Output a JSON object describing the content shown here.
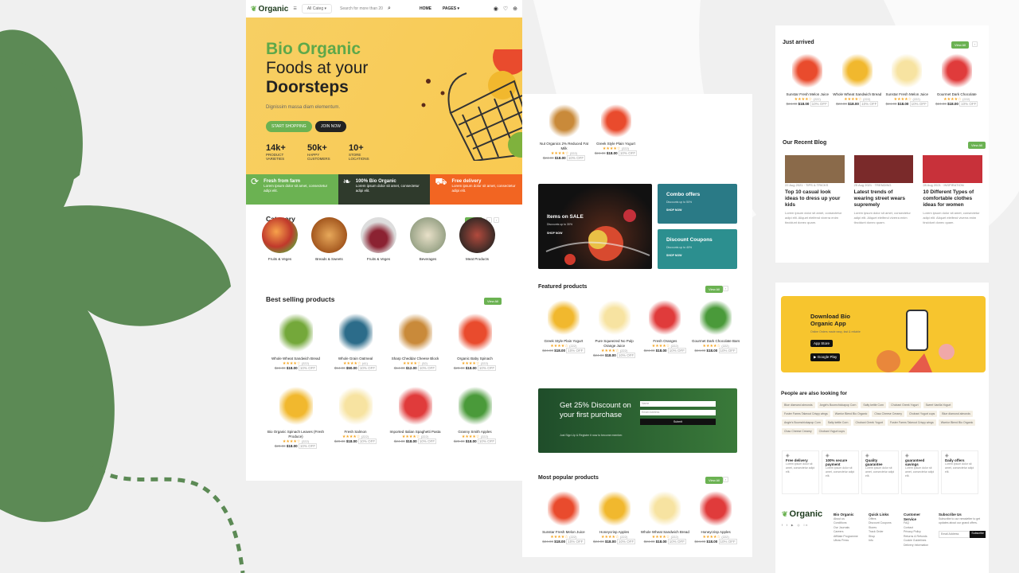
{
  "colors": {
    "brand": "#6bb252",
    "dark": "#1f3a26",
    "orange": "#f26522",
    "hero": "#f7cf63",
    "bg": "#f0f0f0",
    "decor": "#5c8a55"
  },
  "header": {
    "logo": "Organic",
    "category": "All Categ",
    "search_placeholder": "Search for more than 20,0",
    "nav": [
      "HOME",
      "PAGES ▾"
    ],
    "icons": [
      "user-icon",
      "wishlist-icon",
      "cart-icon"
    ]
  },
  "hero": {
    "line1": "Bio Organic",
    "line2": "Foods at your",
    "line3": "Doorsteps",
    "sub": "Dignissim massa diam elementum.",
    "btn1": "START SHOPPING",
    "btn2": "JOIN NOW",
    "stats": [
      {
        "n": "14k+",
        "l": "PRODUCT VARIETIES"
      },
      {
        "n": "50k+",
        "l": "HAPPY CUSTOMERS"
      },
      {
        "n": "10+",
        "l": "STORE LOCATIONS"
      }
    ],
    "features": [
      {
        "t": "Fresh from farm",
        "d": "Lorem ipsum dolor sit amet, consectetur adipi elit.",
        "icon": "recycle-icon"
      },
      {
        "t": "100% Bio Organic",
        "d": "Lorem ipsum dolor sit amet, consectetur adipi elit.",
        "icon": "leaf-icon"
      },
      {
        "t": "Free delivery",
        "d": "Lorem ipsum dolor sit amet, consectetur adipi elit.",
        "icon": "truck-icon"
      }
    ]
  },
  "category": {
    "title": "Category",
    "view_all": "View All",
    "items": [
      "Fruits & Veges",
      "Breads & Sweets",
      "Fruits & Veges",
      "Beverages",
      "Meat Products"
    ]
  },
  "best": {
    "title": "Best selling products",
    "view_all": "View All",
    "items": [
      {
        "name": "Whole Wheat Sandwich Bread",
        "count": "(222)",
        "old": "$24.00",
        "price": "$18.00",
        "off": "10% OFF"
      },
      {
        "name": "Whole Grain Oatmeal",
        "count": "(41)",
        "old": "$54.00",
        "price": "$50.00",
        "off": "10% OFF"
      },
      {
        "name": "Sharp Cheddar Cheese Block",
        "count": "(32)",
        "old": "$14.00",
        "price": "$12.00",
        "off": "10% OFF"
      },
      {
        "name": "Organic Baby Spinach",
        "count": "(222)",
        "old": "$20.00",
        "price": "$18.00",
        "off": "10% OFF"
      },
      {
        "name": "Bio Organic Spinach Leaves (Fresh Produce)",
        "count": "(222)",
        "old": "$20.00",
        "price": "$18.00",
        "off": "10% OFF"
      },
      {
        "name": "Fresh Salmon",
        "count": "(222)",
        "old": "$20.00",
        "price": "$18.00",
        "off": "10% OFF"
      },
      {
        "name": "Imported Italian Spaghetti Pasta",
        "count": "(222)",
        "old": "$24.00",
        "price": "$18.00",
        "off": "10% OFF"
      },
      {
        "name": "Granny Smith Apples",
        "count": "(222)",
        "old": "$20.00",
        "price": "$18.00",
        "off": "10% OFF"
      }
    ]
  },
  "mid_top": [
    {
      "name": "Nut Organics 2% Reduced Fat Milk",
      "count": "(222)",
      "old": "$24.00",
      "price": "$18.00",
      "off": "10% OFF"
    },
    {
      "name": "Greek Style Plain Yogurt",
      "count": "(222)",
      "old": "$24.00",
      "price": "$18.00",
      "off": "10% OFF"
    }
  ],
  "promos": {
    "sale": "Items on SALE",
    "sale_sub": "Discounts up to 30%",
    "combo": "Combo offers",
    "combo_sub": "Discounts up to 50%",
    "coupon": "Discount Coupons",
    "coupon_sub": "Discounts up to 40%",
    "link": "SHOP NOW"
  },
  "featured": {
    "title": "Featured products",
    "view_all": "View All",
    "items": [
      {
        "name": "Greek Style Plain Yogurt",
        "count": "(222)",
        "old": "$24.00",
        "price": "$18.00",
        "off": "10% OFF"
      },
      {
        "name": "Pure Squeezed No Pulp Orange Juice",
        "count": "(222)",
        "old": "$24.00",
        "price": "$18.00",
        "off": "10% OFF"
      },
      {
        "name": "Fresh Oranges",
        "count": "(222)",
        "old": "$24.00",
        "price": "$18.00",
        "off": "10% OFF"
      },
      {
        "name": "Gourmet Dark Chocolate Bars",
        "count": "(222)",
        "old": "$24.00",
        "price": "$18.00",
        "off": "10% OFF"
      }
    ]
  },
  "newsletter": {
    "title": "Get 25% Discount on your first purchase",
    "sub": "Just Sign Up & Register it now to become member.",
    "name_ph": "Name",
    "email_ph": "Email Address",
    "submit": "Submit"
  },
  "popular": {
    "title": "Most popular products",
    "view_all": "View All",
    "items": [
      {
        "name": "Sunstar Fresh Melon Juice",
        "count": "(222)",
        "old": "$24.00",
        "price": "$18.00",
        "off": "10% OFF"
      },
      {
        "name": "Honeycrisp Apples",
        "count": "(222)",
        "old": "$24.00",
        "price": "$18.00",
        "off": "10% OFF"
      },
      {
        "name": "Whole Wheat Sandwich Bread",
        "count": "(222)",
        "old": "$24.00",
        "price": "$18.00",
        "off": "10% OFF"
      },
      {
        "name": "Honeycrisp Apples",
        "count": "(222)",
        "old": "$24.00",
        "price": "$18.00",
        "off": "10% OFF"
      }
    ]
  },
  "arrived": {
    "title": "Just arrived",
    "view_all": "View All",
    "items": [
      {
        "name": "Sunstar Fresh Melon Juice",
        "count": "(222)",
        "old": "$24.00",
        "price": "$18.00",
        "off": "10% OFF"
      },
      {
        "name": "Whole Wheat Sandwich Bread",
        "count": "(222)",
        "old": "$24.00",
        "price": "$18.00",
        "off": "10% OFF"
      },
      {
        "name": "Sunstar Fresh Melon Juice",
        "count": "(222)",
        "old": "$24.00",
        "price": "$18.00",
        "off": "10% OFF"
      },
      {
        "name": "Gourmet Dark Chocolate",
        "count": "(222)",
        "old": "$24.00",
        "price": "$18.00",
        "off": "10% OFF"
      }
    ]
  },
  "blog": {
    "title": "Our Recent Blog",
    "view_all": "View All",
    "posts": [
      {
        "meta": "22 Aug 2021 · TIPS & TRICKS",
        "title": "Top 10 casual look ideas to dress up your kids",
        "body": "Lorem ipsum dolor sit amet, consectetur adipi elit. Aliquet eleifend viverra enim tincidunt donec quam."
      },
      {
        "meta": "25 Aug 2021 · TRENDING",
        "title": "Latest trends of wearing street wears supremely",
        "body": "Lorem ipsum dolor sit amet, consectetur adipi elit. Aliquet eleifend viverra enim tincidunt donec quam."
      },
      {
        "meta": "28 Aug 2021 · INSPIRATION",
        "title": "10 Different Types of comfortable clothes ideas for women",
        "body": "Lorem ipsum dolor sit amet, consectetur adipi elit. Aliquet eleifend viverra enim tincidunt donec quam."
      }
    ]
  },
  "app": {
    "title": "Download Bio Organic App",
    "sub": "Online Orders made easy, fast & reliable",
    "appstore": "App Store",
    "googleplay": "Google Play"
  },
  "looking": {
    "title": "People are also looking for",
    "tags": [
      "Blue diamond almonds",
      "Angie's Boomchickapop Corn",
      "Salty kettle Corn",
      "Chobani Greek Yogurt",
      "Sweet Vanilla Yogurt",
      "Foster Farms Takeout Crispy wings",
      "Warrior Blend Bio Organic",
      "Chao Cheese Creamy",
      "Chobani Yogurt cups",
      "Blue diamond almonds",
      "Angie's Boomchickapop Corn",
      "Salty kettle Corn",
      "Chobani Greek Yogurt",
      "Foster Farms Takeout Crispy wings",
      "Warrior Blend Bio Organic",
      "Chao Cheese Creamy",
      "Chobani Yogurt cups"
    ]
  },
  "services": [
    {
      "t": "Free delivery",
      "d": "Lorem ipsum dolor sit amet, consectetur adipi elit."
    },
    {
      "t": "100% secure payment",
      "d": "Lorem ipsum dolor sit amet, consectetur adipi elit."
    },
    {
      "t": "Quality guarantee",
      "d": "Lorem ipsum dolor sit amet, consectetur adipi elit."
    },
    {
      "t": "guaranteed savings",
      "d": "Lorem ipsum dolor sit amet, consectetur adipi elit."
    },
    {
      "t": "Daily offers",
      "d": "Lorem ipsum dolor sit amet, consectetur adipi elit."
    }
  ],
  "footer": {
    "logo": "Organic",
    "cols": [
      {
        "h": "Bio Organic",
        "l": [
          "About us",
          "Conditions",
          "Our Journals",
          "Careers",
          "Affiliate Programme",
          "Ultras Press"
        ]
      },
      {
        "h": "Quick Links",
        "l": [
          "Offers",
          "Discount Coupons",
          "Stores",
          "Track Order",
          "Shop",
          "Info"
        ]
      },
      {
        "h": "Customer Service",
        "l": [
          "FAQ",
          "Contact",
          "Privacy Policy",
          "Returns & Refunds",
          "Cookie Guidelines",
          "Delivery Information"
        ]
      }
    ],
    "subscribe": {
      "h": "Subscribe Us",
      "d": "Subscribe to our newsletter to get updates about our grand offers.",
      "ph": "Email Address",
      "btn": "Subscribe"
    }
  }
}
